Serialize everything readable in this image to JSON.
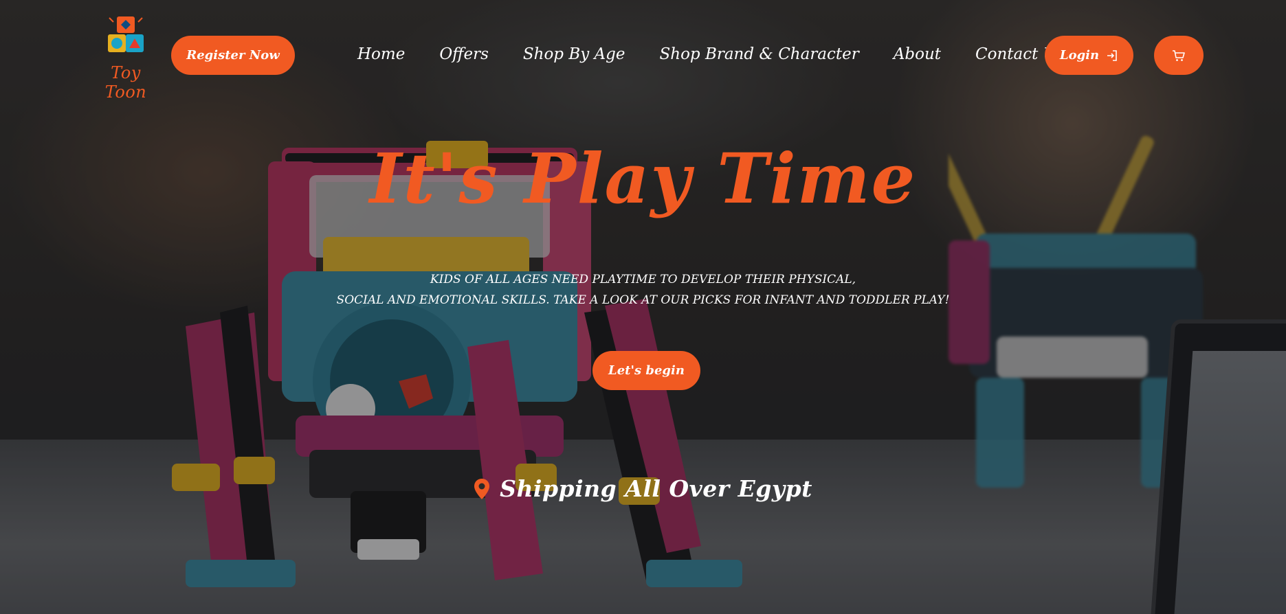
{
  "brand": {
    "name": "Toy Toon"
  },
  "header": {
    "register_label": "Register Now",
    "nav": [
      {
        "label": "Home"
      },
      {
        "label": "Offers"
      },
      {
        "label": "Shop By Age"
      },
      {
        "label": "Shop Brand & Character"
      },
      {
        "label": "About"
      },
      {
        "label": "Contact Us"
      }
    ],
    "login_label": "Login",
    "login_icon": "sign-in-icon",
    "cart_icon": "cart-icon"
  },
  "hero": {
    "title": "It's Play Time",
    "subtitle_line1": "Kids of all ages need playtime to develop their physical,",
    "subtitle_line2": "social and emotional skills. Take a look at our picks for infant and toddler play!",
    "cta_label": "Let's begin"
  },
  "shipping": {
    "text": "Shipping All Over Egypt",
    "icon": "location-pin-icon"
  },
  "colors": {
    "accent": "#f15a22",
    "text": "#ffffff"
  }
}
